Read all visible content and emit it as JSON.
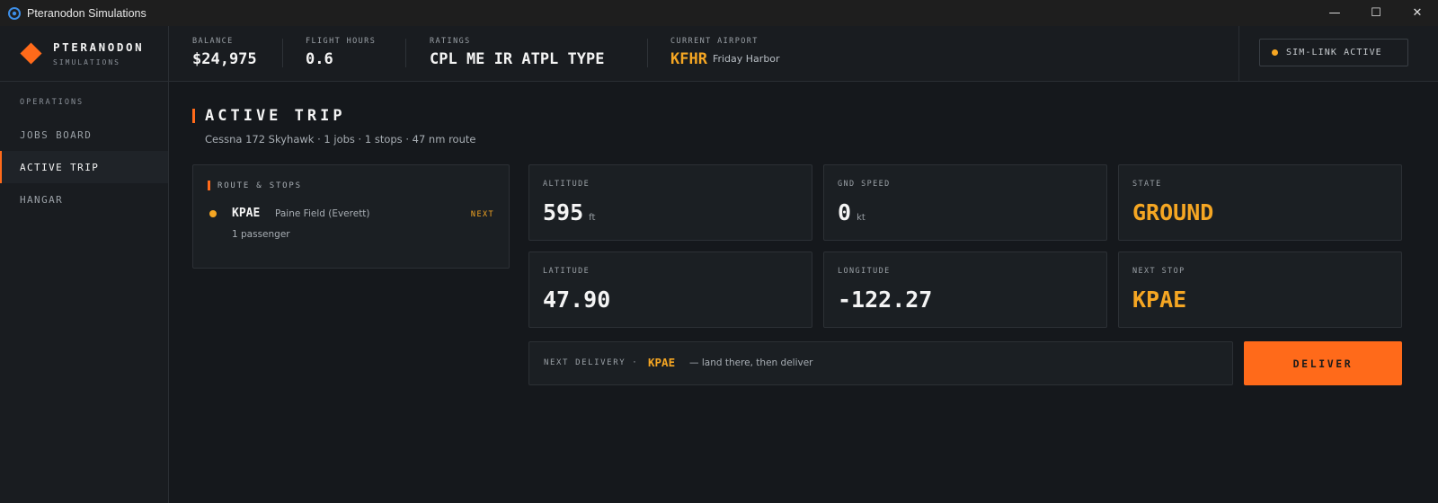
{
  "window": {
    "title": "Pteranodon Simulations",
    "minimize_glyph": "—",
    "maximize_glyph": "☐",
    "close_glyph": "✕"
  },
  "brand": {
    "name": "PTERANODON",
    "subtitle": "SIMULATIONS",
    "accent_color": "#ff6a1a"
  },
  "header": {
    "balance": {
      "label": "BALANCE",
      "value": "$24,975"
    },
    "flight_hours": {
      "label": "FLIGHT HOURS",
      "value": "0.6"
    },
    "ratings": {
      "label": "RATINGS",
      "value": "CPL ME IR ATPL TYPE"
    },
    "current_airport": {
      "label": "CURRENT AIRPORT",
      "code": "KFHR",
      "name": "Friday Harbor"
    },
    "sim_link": {
      "label": "SIM-LINK ACTIVE",
      "status_color": "#f5a623"
    }
  },
  "sidebar": {
    "section": "OPERATIONS",
    "items": [
      {
        "label": "JOBS BOARD",
        "active": false
      },
      {
        "label": "ACTIVE TRIP",
        "active": true
      },
      {
        "label": "HANGAR",
        "active": false
      }
    ]
  },
  "trip": {
    "title": "ACTIVE TRIP",
    "summary": "Cessna 172 Skyhawk · 1 jobs · 1 stops · 47 nm route",
    "route": {
      "heading": "ROUTE & STOPS",
      "stops": [
        {
          "code": "KPAE",
          "name": "Paine Field (Everett)",
          "tag": "NEXT",
          "detail": "1 passenger"
        }
      ]
    },
    "telemetry": {
      "altitude": {
        "label": "ALTITUDE",
        "value": "595",
        "unit": "ft"
      },
      "gnd_speed": {
        "label": "GND SPEED",
        "value": "0",
        "unit": "kt"
      },
      "state": {
        "label": "STATE",
        "value": "GROUND"
      },
      "latitude": {
        "label": "LATITUDE",
        "value": "47.90"
      },
      "longitude": {
        "label": "LONGITUDE",
        "value": "-122.27"
      },
      "next_stop": {
        "label": "NEXT STOP",
        "value": "KPAE"
      }
    },
    "delivery": {
      "label": "NEXT DELIVERY ·",
      "code": "KPAE",
      "note": "— land there, then deliver",
      "button": "DELIVER"
    }
  }
}
